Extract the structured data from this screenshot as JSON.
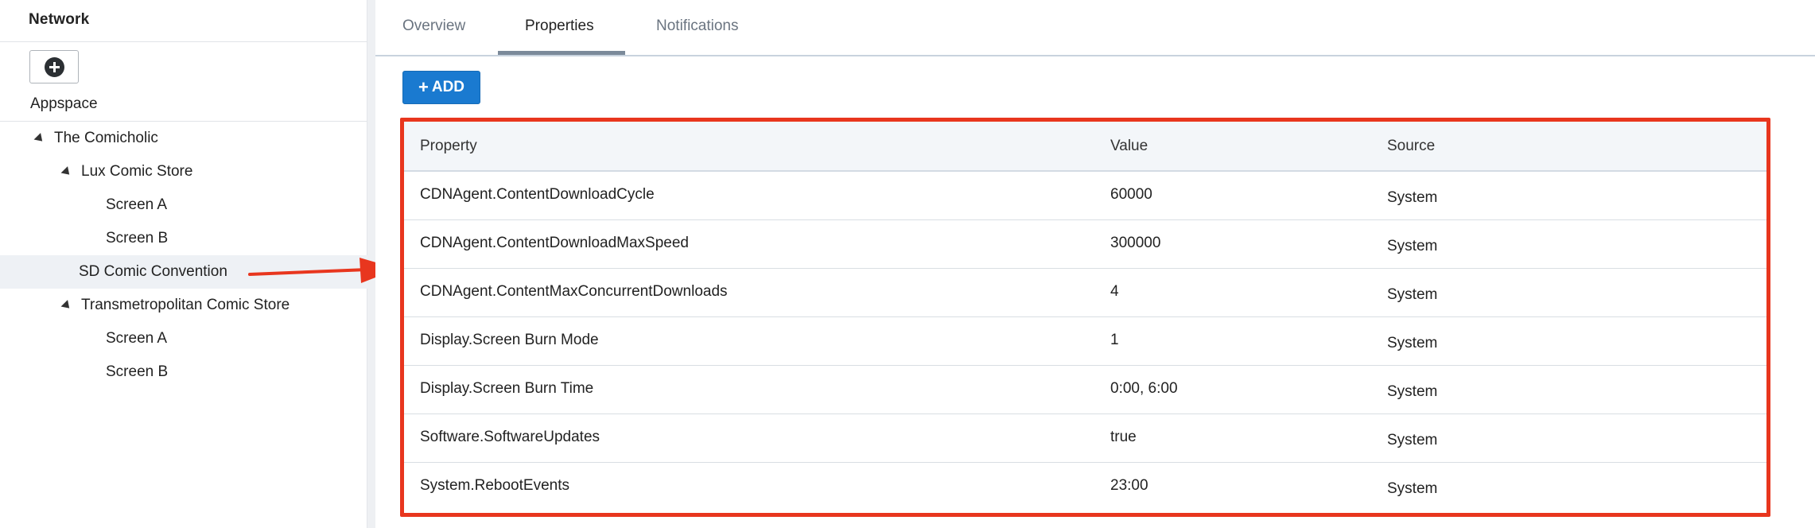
{
  "sidebar": {
    "title": "Network",
    "appspace_label": "Appspace",
    "tree": [
      {
        "label": "The Comicholic",
        "level": 0,
        "expanded": true,
        "selected": false
      },
      {
        "label": "Lux Comic Store",
        "level": 1,
        "expanded": true,
        "selected": false
      },
      {
        "label": "Screen A",
        "level": 2,
        "expanded": false,
        "selected": false
      },
      {
        "label": "Screen B",
        "level": 2,
        "expanded": false,
        "selected": false
      },
      {
        "label": "SD Comic Convention",
        "level": 1,
        "expanded": false,
        "selected": true
      },
      {
        "label": "Transmetropolitan Comic Store",
        "level": 1,
        "expanded": true,
        "selected": false
      },
      {
        "label": "Screen A",
        "level": 2,
        "expanded": false,
        "selected": false
      },
      {
        "label": "Screen B",
        "level": 2,
        "expanded": false,
        "selected": false
      }
    ]
  },
  "tabs": [
    {
      "label": "Overview",
      "active": false
    },
    {
      "label": "Properties",
      "active": true
    },
    {
      "label": "Notifications",
      "active": false
    }
  ],
  "toolbar": {
    "add_label": "ADD"
  },
  "table": {
    "headers": [
      "Property",
      "Value",
      "Source"
    ],
    "rows": [
      [
        "CDNAgent.ContentDownloadCycle",
        "60000",
        "System"
      ],
      [
        "CDNAgent.ContentDownloadMaxSpeed",
        "300000",
        "System"
      ],
      [
        "CDNAgent.ContentMaxConcurrentDownloads",
        "4",
        "System"
      ],
      [
        "Display.Screen Burn Mode",
        "1",
        "System"
      ],
      [
        "Display.Screen Burn Time",
        "0:00, 6:00",
        "System"
      ],
      [
        "Software.SoftwareUpdates",
        "true",
        "System"
      ],
      [
        "System.RebootEvents",
        "23:00",
        "System"
      ]
    ]
  },
  "colors": {
    "accent": "#1a7ad0",
    "highlight_border": "#e8361e",
    "selected_row": "#eef1f5"
  },
  "icons": {
    "add_node": "plus-circle-icon",
    "expand": "triangle-down-icon",
    "annotation": "arrow-right-icon"
  }
}
